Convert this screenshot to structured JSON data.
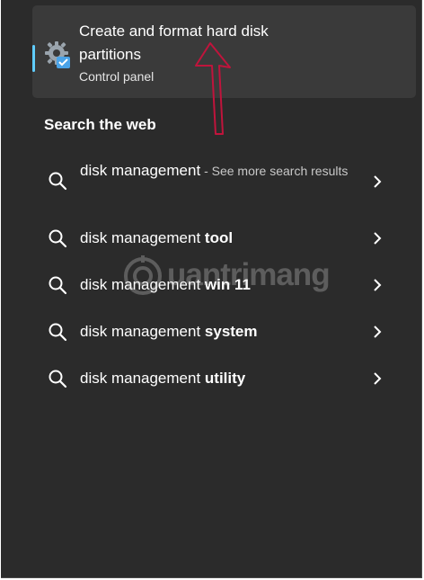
{
  "best_match": {
    "title": "Create and format hard disk partitions",
    "subtitle": "Control panel",
    "icon": "control-panel-gear-icon"
  },
  "web_section": {
    "title": "Search the web"
  },
  "results": [
    {
      "prefix": "disk management",
      "bold": "",
      "hint": " - See more search results"
    },
    {
      "prefix": "disk management ",
      "bold": "tool",
      "hint": ""
    },
    {
      "prefix": "disk management ",
      "bold": "win 11",
      "hint": ""
    },
    {
      "prefix": "disk management ",
      "bold": "system",
      "hint": ""
    },
    {
      "prefix": "disk management ",
      "bold": "utility",
      "hint": ""
    }
  ],
  "watermark": {
    "text": "uantrimang"
  },
  "colors": {
    "background": "#2b2b2b",
    "card": "#3a3a3a",
    "accent": "#60cdff",
    "arrow": "#c0143c"
  }
}
